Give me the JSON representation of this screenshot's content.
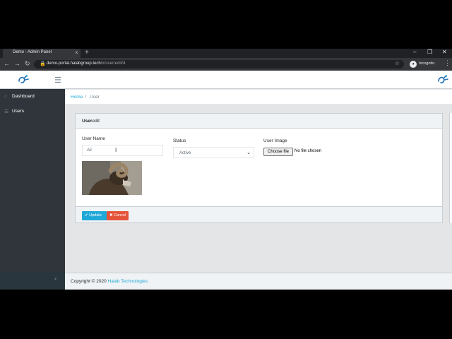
{
  "browser": {
    "tab_title": "Demo - Admin Panel",
    "tab_close": "×",
    "new_tab": "+",
    "url_host": "demo-portal.halabgroup.tech",
    "url_path": "/#/user/edit/4",
    "incognito_label": "Incognito",
    "min_icon": "–",
    "max_icon": "❐",
    "close_icon": "✕",
    "back_icon": "←",
    "forward_icon": "→",
    "reload_icon": "↻",
    "lock_icon": "🔒",
    "star_icon": "☆",
    "menu_icon": "⋮"
  },
  "header": {
    "hamburger": "☰"
  },
  "sidebar": {
    "items": [
      {
        "label": "Dashboard",
        "icon": "⌂"
      },
      {
        "label": "Users",
        "icon": "☰"
      }
    ],
    "collapse_icon": "‹"
  },
  "breadcrumb": {
    "home": "Home",
    "separator": "/",
    "current": "User"
  },
  "card": {
    "title_bold": "User",
    "title_rest": "edit",
    "username_label": "User Name",
    "username_value": "Ali",
    "status_label": "Status",
    "status_value": "Active",
    "image_label": "User Image",
    "choose_file": "Choose file",
    "no_file": "No file chosen",
    "update_label": "✔ Update",
    "cancel_label": "✖ Cancel"
  },
  "footer": {
    "copyright": "Copyright © 2020 ",
    "company": "Halab Technologies"
  },
  "colors": {
    "primary": "#20a8d8",
    "danger": "#e5533a",
    "sidebar": "#2f353a"
  }
}
